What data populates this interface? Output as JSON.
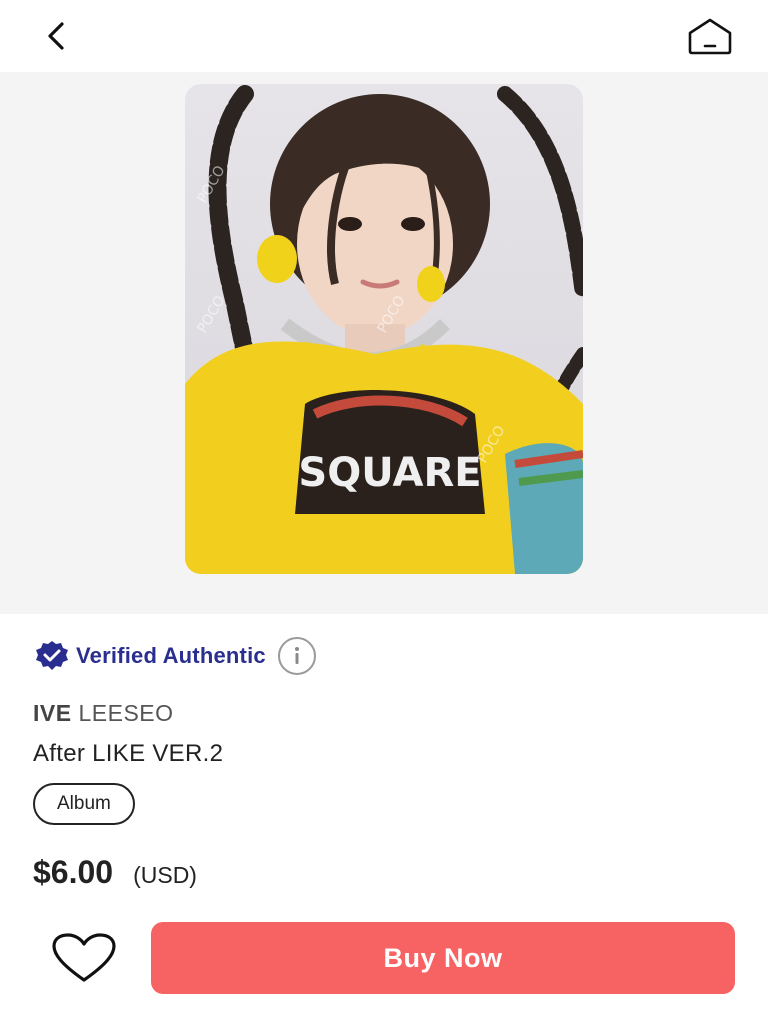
{
  "nav": {
    "back_icon": "chevron-left-icon",
    "home_icon": "home-icon"
  },
  "product": {
    "image": {
      "description_icon": "photocard-image",
      "shirt_text": "SQUARE",
      "watermark": "POCO"
    },
    "verified_label": "Verified Authentic",
    "verified_icon": "verified-badge-icon",
    "info_icon": "info-icon",
    "group": "IVE",
    "member": "LEESEO",
    "title": "After LIKE VER.2",
    "category": "Album",
    "price": "$6.00",
    "currency": "(USD)"
  },
  "actions": {
    "wishlist_icon": "heart-icon",
    "buy_label": "Buy Now"
  },
  "colors": {
    "accent": "#f76262",
    "verified": "#2a2f8f",
    "gallery_bg": "#f4f4f4"
  }
}
